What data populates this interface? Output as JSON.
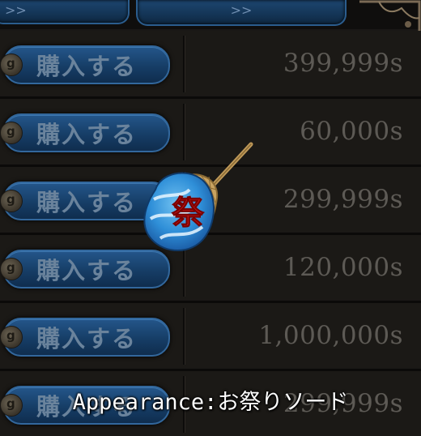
{
  "nav": {
    "left_label": ">>",
    "right_label": ">>"
  },
  "shop_rows": [
    {
      "buy_label": "購入する",
      "price": "399,999s"
    },
    {
      "buy_label": "購入する",
      "price": "60,000s"
    },
    {
      "buy_label": "購入する",
      "price": "299,999s"
    },
    {
      "buy_label": "購入する",
      "price": "120,000s"
    },
    {
      "buy_label": "購入する",
      "price": "1,000,000s"
    },
    {
      "buy_label": "購入する",
      "price": "299,999s"
    }
  ],
  "preview": {
    "item_icon": "festival-uchiwa-fan-icon",
    "fan_text": "祭"
  },
  "caption": "Appearance:お祭りソード",
  "colors": {
    "button_blue": "#1a4670",
    "price_gray": "#5d5a55",
    "bg": "#1b1916"
  }
}
